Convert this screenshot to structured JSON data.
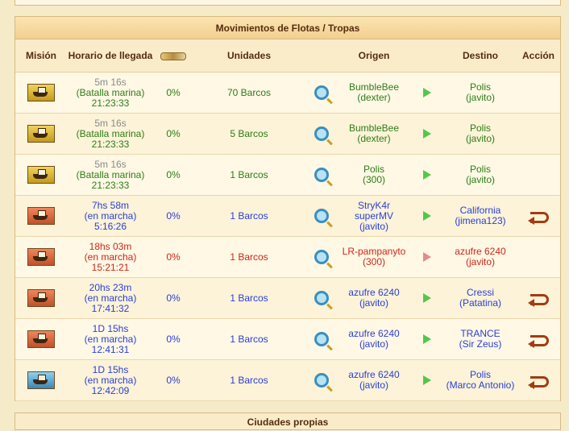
{
  "panel": {
    "title": "Movimientos de Flotas / Tropas"
  },
  "headers": {
    "mission": "Misión",
    "arrival": "Horario de llegada",
    "units": "Unidades",
    "origin": "Origen",
    "destination": "Destino",
    "action": "Acción"
  },
  "rows": [
    {
      "mission_icon": "battle-icon",
      "time": "5m 16s",
      "status": "(Batalla marina)",
      "clock": "21:23:33",
      "percent": "0%",
      "units": "70 Barcos",
      "origin_name": "BumbleBee",
      "origin_owner": "(dexter)",
      "dest_name": "Polis",
      "dest_owner": "(javito)",
      "color": "green",
      "time_color": "gray",
      "has_action": false
    },
    {
      "mission_icon": "battle-icon",
      "time": "5m 16s",
      "status": "(Batalla marina)",
      "clock": "21:23:33",
      "percent": "0%",
      "units": "5 Barcos",
      "origin_name": "BumbleBee",
      "origin_owner": "(dexter)",
      "dest_name": "Polis",
      "dest_owner": "(javito)",
      "color": "green",
      "time_color": "gray",
      "has_action": false
    },
    {
      "mission_icon": "battle-icon",
      "time": "5m 16s",
      "status": "(Batalla marina)",
      "clock": "21:23:33",
      "percent": "0%",
      "units": "1 Barcos",
      "origin_name": "Polis",
      "origin_owner": "(300)",
      "dest_name": "Polis",
      "dest_owner": "(javito)",
      "color": "green",
      "time_color": "gray",
      "has_action": false
    },
    {
      "mission_icon": "transport-icon",
      "time": "7hs 58m",
      "status": "(en marcha)",
      "clock": "5:16:26",
      "percent": "0%",
      "units": "1 Barcos",
      "origin_name": "StryK4r superMV",
      "origin_owner": "(javito)",
      "dest_name": "California",
      "dest_owner": "(jimena123)",
      "color": "blue",
      "time_color": "blue",
      "has_action": true
    },
    {
      "mission_icon": "transport-icon",
      "time": "18hs 03m",
      "status": "(en marcha)",
      "clock": "15:21:21",
      "percent": "0%",
      "units": "1 Barcos",
      "origin_name": "LR-pampanyto",
      "origin_owner": "(300)",
      "dest_name": "azufre 6240",
      "dest_owner": "(javito)",
      "color": "red",
      "time_color": "red",
      "has_action": false
    },
    {
      "mission_icon": "transport-icon",
      "time": "20hs 23m",
      "status": "(en marcha)",
      "clock": "17:41:32",
      "percent": "0%",
      "units": "1 Barcos",
      "origin_name": "azufre 6240",
      "origin_owner": "(javito)",
      "dest_name": "Cressi",
      "dest_owner": "(Patatina)",
      "color": "blue",
      "time_color": "blue",
      "has_action": true
    },
    {
      "mission_icon": "transport-icon",
      "time": "1D 15hs",
      "status": "(en marcha)",
      "clock": "12:41:31",
      "percent": "0%",
      "units": "1 Barcos",
      "origin_name": "azufre 6240",
      "origin_owner": "(javito)",
      "dest_name": "TRANCE",
      "dest_owner": "(Sir Zeus)",
      "color": "blue",
      "time_color": "blue",
      "has_action": true
    },
    {
      "mission_icon": "colony-icon",
      "time": "1D 15hs",
      "status": "(en marcha)",
      "clock": "12:42:09",
      "percent": "0%",
      "units": "1 Barcos",
      "origin_name": "azufre 6240",
      "origin_owner": "(javito)",
      "dest_name": "Polis",
      "dest_owner": "(Marco Antonio)",
      "color": "blue",
      "time_color": "blue",
      "has_action": true
    }
  ],
  "bottom_panel": {
    "title": "Ciudades propias"
  }
}
